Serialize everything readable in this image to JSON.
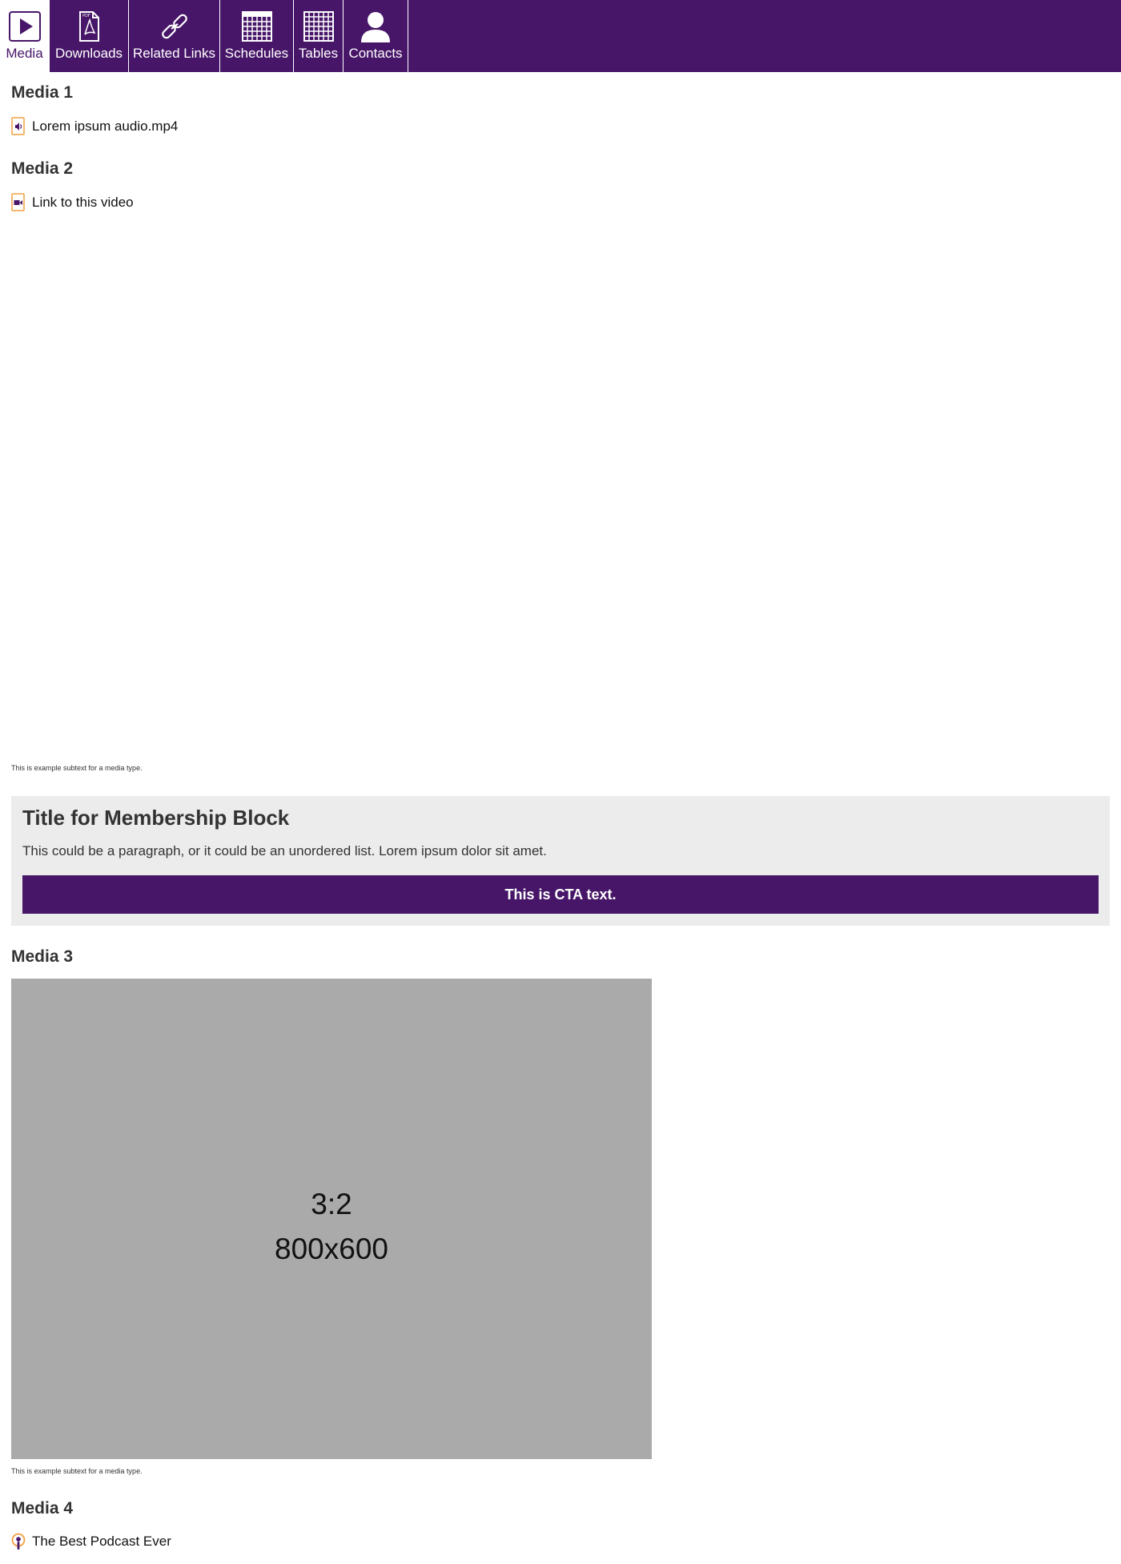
{
  "tabs": [
    {
      "label": "Media",
      "icon": "play-icon",
      "active": true
    },
    {
      "label": "Downloads",
      "icon": "pdf-file-icon",
      "active": false
    },
    {
      "label": "Related Links",
      "icon": "link-icon",
      "active": false
    },
    {
      "label": "Schedules",
      "icon": "calendar-grid-icon",
      "active": false
    },
    {
      "label": "Tables",
      "icon": "table-grid-icon",
      "active": false
    },
    {
      "label": "Contacts",
      "icon": "person-icon",
      "active": false
    }
  ],
  "media1": {
    "heading": "Media 1",
    "link_text": "Lorem ipsum audio.mp4",
    "icon": "audio-file-icon"
  },
  "media2": {
    "heading": "Media 2",
    "link_text": "Link to this video",
    "icon": "video-file-icon",
    "subtext": "This is example subtext for a media type."
  },
  "membership": {
    "title": "Title for Membership Block",
    "text": "This could be a paragraph, or it could be an unordered list. Lorem ipsum dolor sit amet.",
    "cta": "This is CTA text."
  },
  "media3": {
    "heading": "Media 3",
    "ratio": "3:2",
    "dimensions": "800x600",
    "subtext": "This is example subtext for a media type."
  },
  "media4": {
    "heading": "Media 4",
    "link_text": "The Best Podcast Ever",
    "icon": "podcast-icon"
  },
  "colors": {
    "brand": "#471668",
    "accent_orange": "#f0a040",
    "panel_bg": "#ececec",
    "placeholder_bg": "#aaaaaa"
  }
}
